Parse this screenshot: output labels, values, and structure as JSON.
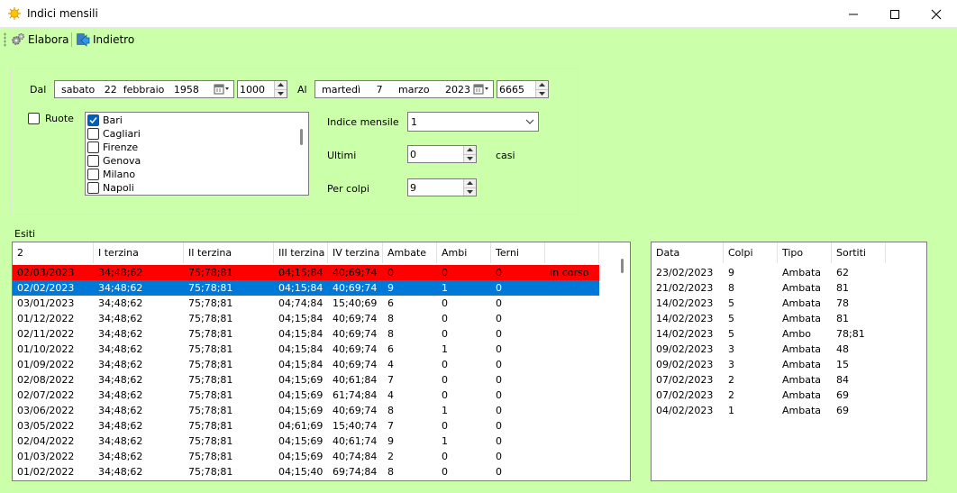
{
  "window": {
    "title": "Indici mensili",
    "accent": "#ccffaa"
  },
  "toolbar": {
    "elabora_label": "Elabora",
    "indietro_label": "Indietro"
  },
  "filters": {
    "dal_label": "Dal",
    "dal_date": "sabato   22  febbraio   1958",
    "dal_number": "1000",
    "al_label": "Al",
    "al_date": "martedì     7     marzo     2023",
    "al_number": "6665",
    "ruote_label": "Ruote",
    "ruote_checked": false,
    "ruote_list": [
      {
        "label": "Bari",
        "checked": true
      },
      {
        "label": "Cagliari",
        "checked": false
      },
      {
        "label": "Firenze",
        "checked": false
      },
      {
        "label": "Genova",
        "checked": false
      },
      {
        "label": "Milano",
        "checked": false
      },
      {
        "label": "Napoli",
        "checked": false
      }
    ],
    "indice_label": "Indice mensile",
    "indice_value": "1",
    "ultimi_label": "Ultimi",
    "ultimi_value": "0",
    "casi_label": "casi",
    "percolpi_label": "Per colpi",
    "percolpi_value": "9"
  },
  "esiti": {
    "label": "Esiti",
    "columns": [
      "2",
      "I terzina",
      "II terzina",
      "III terzina",
      "IV terzina",
      "Ambate",
      "Ambi",
      "Terni",
      ""
    ],
    "rows": [
      [
        "02/03/2023",
        "34;48;62",
        "75;78;81",
        "04;15;84",
        "40;69;74",
        "0",
        "0",
        "0",
        "In corso"
      ],
      [
        "02/02/2023",
        "34;48;62",
        "75;78;81",
        "04;15;84",
        "40;69;74",
        "9",
        "1",
        "0",
        ""
      ],
      [
        "03/01/2023",
        "34;48;62",
        "75;78;81",
        "04;74;84",
        "15;40;69",
        "6",
        "0",
        "0",
        ""
      ],
      [
        "01/12/2022",
        "34;48;62",
        "75;78;81",
        "04;15;84",
        "40;69;74",
        "8",
        "0",
        "0",
        ""
      ],
      [
        "02/11/2022",
        "34;48;62",
        "75;78;81",
        "04;15;84",
        "40;69;74",
        "8",
        "0",
        "0",
        ""
      ],
      [
        "01/10/2022",
        "34;48;62",
        "75;78;81",
        "04;15;84",
        "40;69;74",
        "6",
        "1",
        "0",
        ""
      ],
      [
        "01/09/2022",
        "34;48;62",
        "75;78;81",
        "04;15;84",
        "40;69;74",
        "4",
        "0",
        "0",
        ""
      ],
      [
        "02/08/2022",
        "34;48;62",
        "75;78;81",
        "04;15;69",
        "40;61;84",
        "7",
        "0",
        "0",
        ""
      ],
      [
        "02/07/2022",
        "34;48;62",
        "75;78;81",
        "04;15;69",
        "61;74;84",
        "4",
        "0",
        "0",
        ""
      ],
      [
        "03/06/2022",
        "34;48;62",
        "75;78;81",
        "04;15;69",
        "40;69;74",
        "8",
        "1",
        "0",
        ""
      ],
      [
        "03/05/2022",
        "34;48;62",
        "75;78;81",
        "04;61;69",
        "15;40;74",
        "7",
        "0",
        "0",
        ""
      ],
      [
        "02/04/2022",
        "34;48;62",
        "75;78;81",
        "04;15;69",
        "40;61;74",
        "9",
        "1",
        "0",
        ""
      ],
      [
        "01/03/2022",
        "34;48;62",
        "75;78;81",
        "04;15;69",
        "40;74;84",
        "2",
        "0",
        "0",
        ""
      ],
      [
        "01/02/2022",
        "34;48;62",
        "75;78;81",
        "04;15;40",
        "69;74;84",
        "8",
        "0",
        "0",
        ""
      ]
    ],
    "row_colors": {
      "in_corso": "#ff0000",
      "selected": "#0078d7"
    }
  },
  "dettaglio": {
    "columns": [
      "Data",
      "Colpi",
      "Tipo",
      "Sortiti"
    ],
    "rows": [
      [
        "23/02/2023",
        "9",
        "Ambata",
        "62"
      ],
      [
        "21/02/2023",
        "8",
        "Ambata",
        "81"
      ],
      [
        "14/02/2023",
        "5",
        "Ambata",
        "78"
      ],
      [
        "14/02/2023",
        "5",
        "Ambata",
        "81"
      ],
      [
        "14/02/2023",
        "5",
        "Ambo",
        "78;81"
      ],
      [
        "09/02/2023",
        "3",
        "Ambata",
        "48"
      ],
      [
        "09/02/2023",
        "3",
        "Ambata",
        "15"
      ],
      [
        "07/02/2023",
        "2",
        "Ambata",
        "84"
      ],
      [
        "07/02/2023",
        "2",
        "Ambata",
        "69"
      ],
      [
        "04/02/2023",
        "1",
        "Ambata",
        "69"
      ]
    ]
  }
}
